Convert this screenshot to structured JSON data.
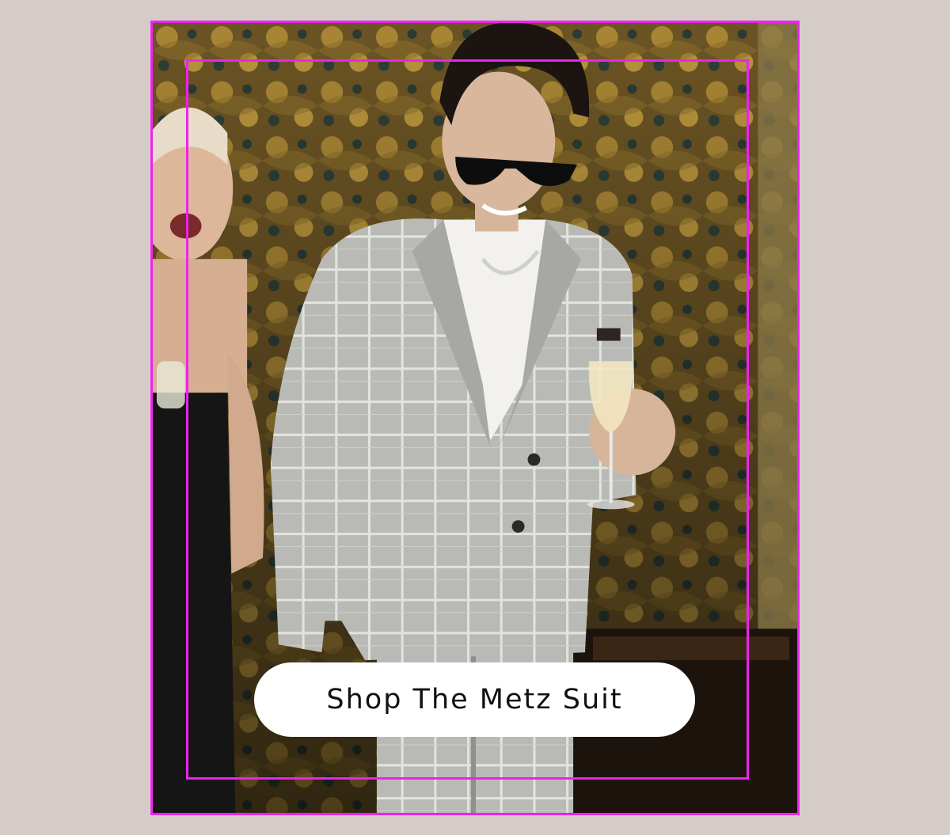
{
  "hero": {
    "cta_label": "Shop The Metz Suit"
  },
  "colors": {
    "page_background": "#d5ccc8",
    "frame_accent": "#ee22ee",
    "cta_background": "#ffffff",
    "cta_text": "#111111"
  }
}
